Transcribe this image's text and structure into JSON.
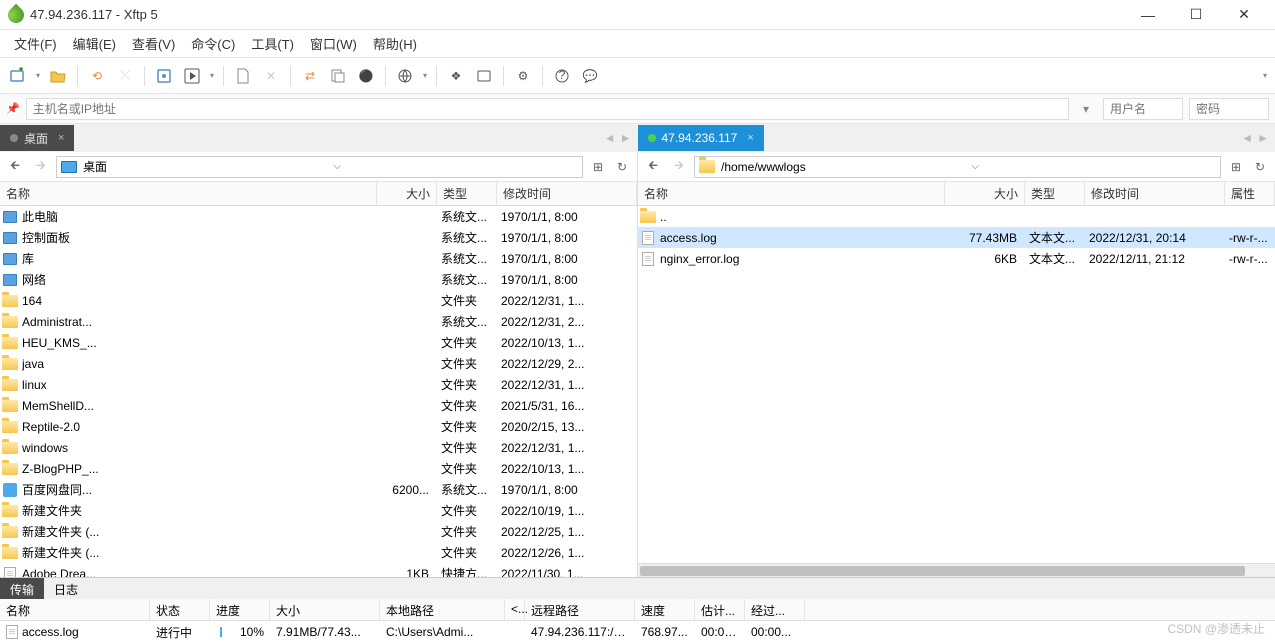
{
  "window": {
    "title": "47.94.236.117    - Xftp 5"
  },
  "menu": [
    "文件(F)",
    "编辑(E)",
    "查看(V)",
    "命令(C)",
    "工具(T)",
    "窗口(W)",
    "帮助(H)"
  ],
  "addressbar": {
    "host_placeholder": "主机名或IP地址",
    "user_placeholder": "用户名",
    "pass_placeholder": "密码"
  },
  "tabs": {
    "left": {
      "label": "桌面"
    },
    "right": {
      "label": "47.94.236.117"
    }
  },
  "pathbar": {
    "left": "桌面",
    "right": "/home/wwwlogs"
  },
  "headers": {
    "name": "名称",
    "size": "大小",
    "type": "类型",
    "date": "修改时间",
    "attr": "属性"
  },
  "left_rows": [
    {
      "ico": "sys",
      "name": "此电脑",
      "size": "",
      "type": "系统文...",
      "date": "1970/1/1, 8:00"
    },
    {
      "ico": "sys",
      "name": "控制面板",
      "size": "",
      "type": "系统文...",
      "date": "1970/1/1, 8:00"
    },
    {
      "ico": "sys",
      "name": "库",
      "size": "",
      "type": "系统文...",
      "date": "1970/1/1, 8:00"
    },
    {
      "ico": "sys",
      "name": "网络",
      "size": "",
      "type": "系统文...",
      "date": "1970/1/1, 8:00"
    },
    {
      "ico": "folder",
      "name": "164",
      "size": "",
      "type": "文件夹",
      "date": "2022/12/31, 1..."
    },
    {
      "ico": "folder",
      "name": "Administrat...",
      "size": "",
      "type": "系统文...",
      "date": "2022/12/31, 2..."
    },
    {
      "ico": "folder",
      "name": "HEU_KMS_...",
      "size": "",
      "type": "文件夹",
      "date": "2022/10/13, 1..."
    },
    {
      "ico": "folder",
      "name": "java",
      "size": "",
      "type": "文件夹",
      "date": "2022/12/29, 2..."
    },
    {
      "ico": "folder",
      "name": "linux",
      "size": "",
      "type": "文件夹",
      "date": "2022/12/31, 1..."
    },
    {
      "ico": "folder",
      "name": "MemShellD...",
      "size": "",
      "type": "文件夹",
      "date": "2021/5/31, 16..."
    },
    {
      "ico": "folder",
      "name": "Reptile-2.0",
      "size": "",
      "type": "文件夹",
      "date": "2020/2/15, 13..."
    },
    {
      "ico": "folder",
      "name": "windows",
      "size": "",
      "type": "文件夹",
      "date": "2022/12/31, 1..."
    },
    {
      "ico": "folder",
      "name": "Z-BlogPHP_...",
      "size": "",
      "type": "文件夹",
      "date": "2022/10/13, 1..."
    },
    {
      "ico": "blue",
      "name": "百度网盘同...",
      "size": "6200...",
      "type": "系统文...",
      "date": "1970/1/1, 8:00"
    },
    {
      "ico": "folder",
      "name": "新建文件夹",
      "size": "",
      "type": "文件夹",
      "date": "2022/10/19, 1..."
    },
    {
      "ico": "folder",
      "name": "新建文件夹 (...",
      "size": "",
      "type": "文件夹",
      "date": "2022/12/25, 1..."
    },
    {
      "ico": "folder",
      "name": "新建文件夹 (...",
      "size": "",
      "type": "文件夹",
      "date": "2022/12/26, 1..."
    },
    {
      "ico": "file",
      "name": "Adobe Drea...",
      "size": "1KB",
      "type": "快捷方...",
      "date": "2022/11/30, 1..."
    }
  ],
  "right_rows": [
    {
      "ico": "folder",
      "name": "..",
      "size": "",
      "type": "",
      "date": "",
      "attr": ""
    },
    {
      "ico": "file",
      "name": "access.log",
      "size": "77.43MB",
      "type": "文本文...",
      "date": "2022/12/31, 20:14",
      "attr": "-rw-r-...",
      "selected": true
    },
    {
      "ico": "file",
      "name": "nginx_error.log",
      "size": "6KB",
      "type": "文本文...",
      "date": "2022/12/11, 21:12",
      "attr": "-rw-r-..."
    }
  ],
  "bottom_tabs": {
    "transfer": "传输",
    "log": "日志"
  },
  "transfer_headers": {
    "name": "名称",
    "status": "状态",
    "progress": "进度",
    "size": "大小",
    "local": "本地路径",
    "arrow": "<...",
    "remote": "远程路径",
    "speed": "速度",
    "est": "估计...",
    "elapsed": "经过..."
  },
  "transfer": {
    "name": "access.log",
    "status": "进行中",
    "progress": "10%",
    "size": "7.91MB/77.43...",
    "local": "C:\\Users\\Admi...",
    "remote": "47.94.236.117:/h...",
    "speed": "768.97...",
    "est": "00:01...",
    "elapsed": "00:00..."
  },
  "watermark": "CSDN @渗透未止"
}
